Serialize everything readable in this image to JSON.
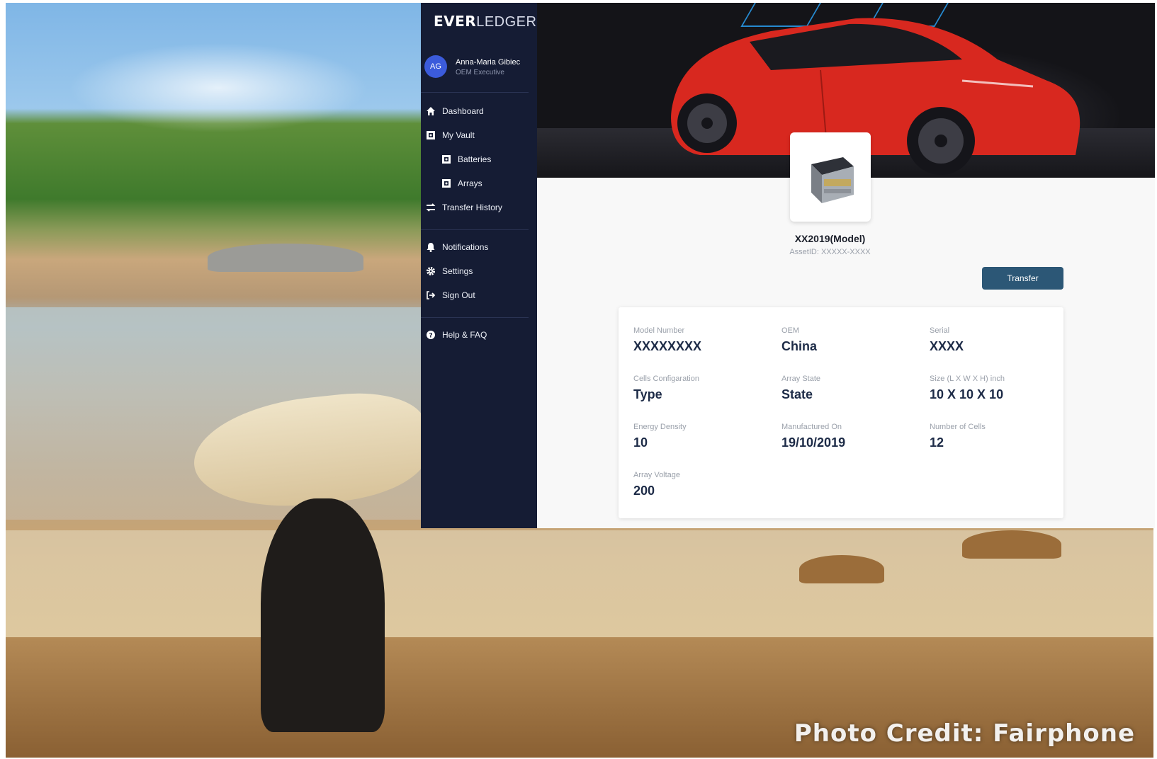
{
  "photo_credit": "Photo Credit: Fairphone",
  "sidebar": {
    "logo_bold": "EVER",
    "logo_light": "LEDGER",
    "user": {
      "initials": "AG",
      "name": "Anna-Maria Gibiec",
      "role": "OEM Executive"
    },
    "items": [
      {
        "label": "Dashboard",
        "icon": "home-icon"
      },
      {
        "label": "My Vault",
        "icon": "vault-icon"
      },
      {
        "label": "Batteries",
        "icon": "vault-icon"
      },
      {
        "label": "Arrays",
        "icon": "vault-icon"
      },
      {
        "label": "Transfer History",
        "icon": "transfer-icon"
      },
      {
        "label": "Notifications",
        "icon": "bell-icon"
      },
      {
        "label": "Settings",
        "icon": "gear-icon"
      },
      {
        "label": "Sign Out",
        "icon": "sign-out-icon"
      },
      {
        "label": "Help & FAQ",
        "icon": "question-icon"
      }
    ]
  },
  "asset": {
    "title": "XX2019(Model)",
    "asset_id": "AssetID: XXXXX-XXXX",
    "transfer_label": "Transfer"
  },
  "details": [
    {
      "label": "Model Number",
      "value": "XXXXXXXX"
    },
    {
      "label": "OEM",
      "value": "China"
    },
    {
      "label": "Serial",
      "value": "XXXX"
    },
    {
      "label": "Cells Configaration",
      "value": "Type"
    },
    {
      "label": "Array State",
      "value": "State"
    },
    {
      "label": "Size (L X W X H) inch",
      "value": "10 X 10 X 10"
    },
    {
      "label": "Energy Density",
      "value": "10"
    },
    {
      "label": "Manufactured On",
      "value": "19/10/2019"
    },
    {
      "label": "Number of Cells",
      "value": "12"
    },
    {
      "label": "Array Voltage",
      "value": "200"
    }
  ],
  "colors": {
    "sidebar": "#151c34",
    "button": "#2c5776",
    "car": "#d8281f",
    "avatar": "#3b5bdb"
  }
}
